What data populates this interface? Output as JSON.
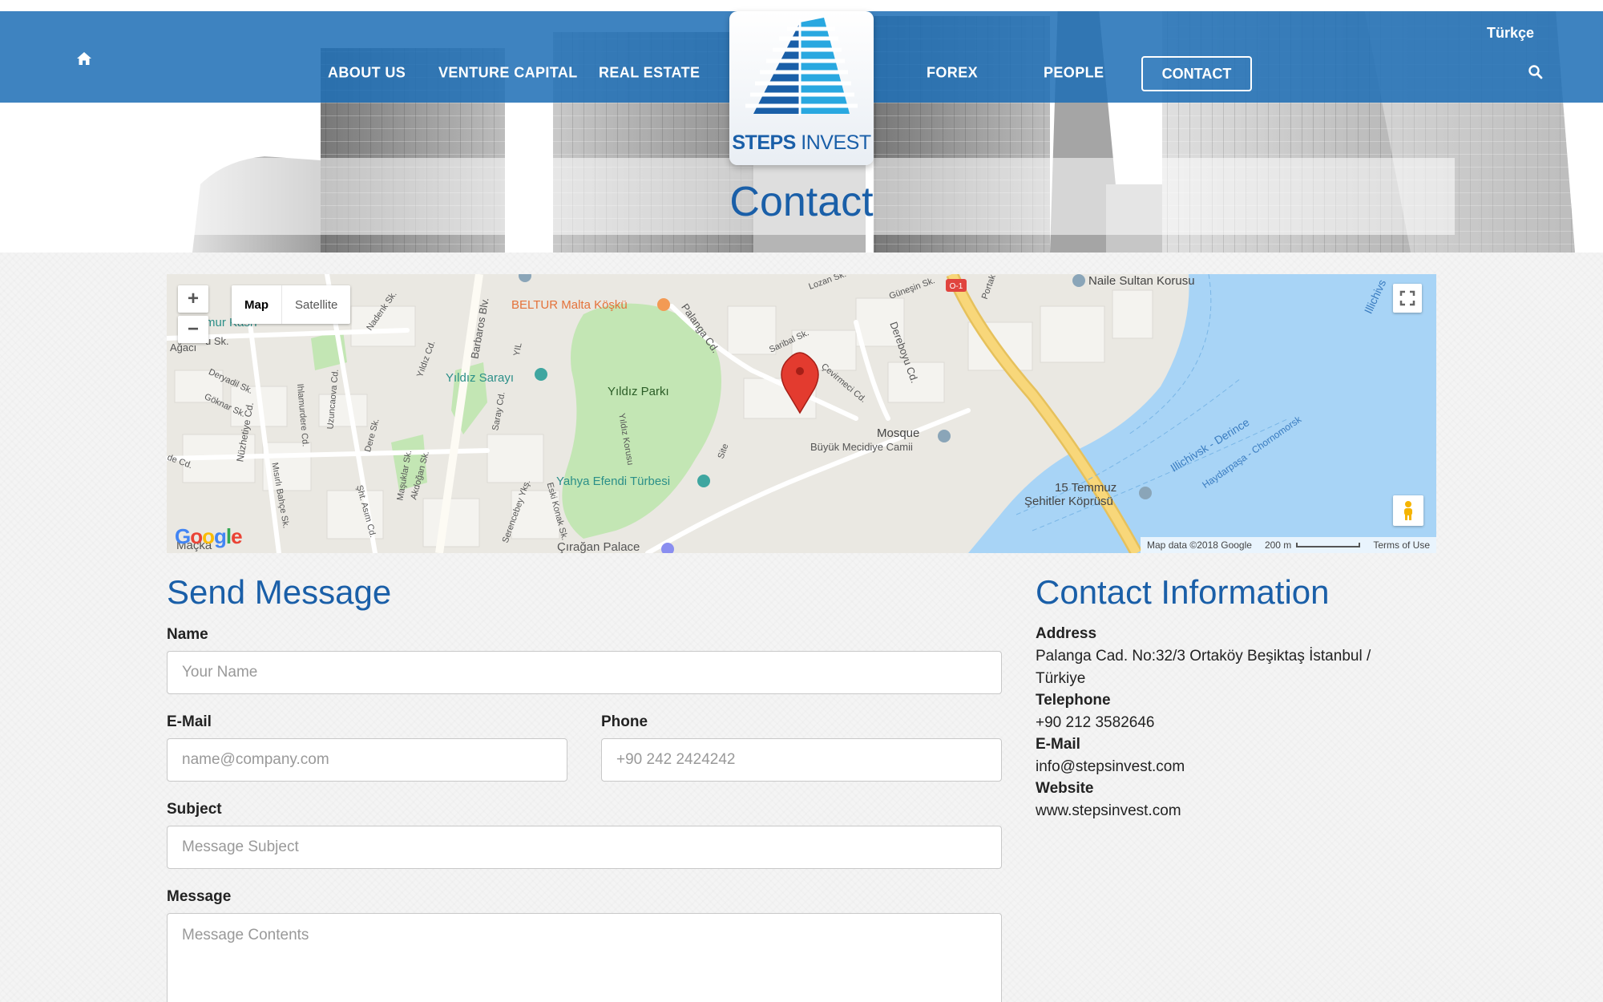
{
  "nav": {
    "items": [
      {
        "label": "ABOUT US"
      },
      {
        "label": "VENTURE CAPITAL"
      },
      {
        "label": "REAL ESTATE"
      },
      {
        "label": "FOREX"
      },
      {
        "label": "PEOPLE"
      },
      {
        "label": "CONTACT"
      }
    ],
    "language": "Türkçe"
  },
  "logo": {
    "bold": "STEPS",
    "light": " INVEST"
  },
  "page_title": "Contact",
  "map": {
    "type_map": "Map",
    "type_satellite": "Satellite",
    "zoom_in": "+",
    "zoom_out": "−",
    "attribution": "Map data ©2018 Google",
    "scale": "200 m",
    "terms": "Terms of Use",
    "google": "Google",
    "places": {
      "beltur": "BELTUR Malta Köşkü",
      "yildiz_sarayi": "Yıldız Sarayı",
      "yildiz_parki": "Yıldız Parkı",
      "yahya": "Yahya Efendi Türbesi",
      "ciragan": "Çırağan Palace",
      "mosque": "Mosque",
      "buyuk_mecidiye": "Büyük Mecidiye Camii",
      "naile": "Naile Sultan Korusu",
      "bridge_1": "15 Temmuz",
      "bridge_2": "Şehitler Köprüsü",
      "ferry_1": "Illichivsk - Derince",
      "ferry_2": "Haydarpaşa - Chornomorsk",
      "ferry_3": "Illichivs",
      "macka": "Maçka",
      "kasri": "mur Kasrı",
      "agaci": "Ağacı",
      "su_sk": "u Sk."
    },
    "streets": {
      "barbaros": "Barbaros Blv.",
      "palanga": "Palanga Cd.",
      "dereboyu": "Dereboyu Cd.",
      "portakal": "Portak",
      "lozan": "Lozan Sk.",
      "gunekin": "Güneşin Sk.",
      "saribal": "Saribal Sk.",
      "cevirmeci": "Çevirmeci Cd.",
      "nuzhetiye": "Nüzhetiye Cd.",
      "deryadil": "Deryadil Sk.",
      "goknar": "Göknar Sk.",
      "ilhamurdere": "Ihlamurdere Cd.",
      "misirli": "Mısırlı Bahçe Sk.",
      "uzuncaova": "Uzuncaova Cd.",
      "dere": "Dere Sk.",
      "sht_asim": "Şht. Asım Cd.",
      "masuklar": "Maşuklar Sk.",
      "akdogan": "Akdoğan Sk.",
      "yildiz_cd": "Yıldız Cd.",
      "saray_cd": "Saray Cd.",
      "serencebey": "Serencebey Ykş.",
      "eski_konak": "Eski Konak Sk.",
      "yildiz_korusu": "Yıldız Korusu",
      "nadenk": "Nadenk Sk.",
      "site": "Site",
      "de_cd": "de Cd.",
      "yil": "YIL",
      "o1": "O-1"
    }
  },
  "form": {
    "title": "Send Message",
    "name_label": "Name",
    "name_placeholder": "Your Name",
    "email_label": "E-Mail",
    "email_placeholder": "name@company.com",
    "phone_label": "Phone",
    "phone_placeholder": "+90 242 2424242",
    "subject_label": "Subject",
    "subject_placeholder": "Message Subject",
    "message_label": "Message",
    "message_placeholder": "Message Contents"
  },
  "contact_info": {
    "title": "Contact Information",
    "address_label": "Address",
    "address_line1": "Palanga Cad. No:32/3 Ortaköy Beşiktaş İstanbul /",
    "address_line2": "Türkiye",
    "telephone_label": "Telephone",
    "telephone": "+90 212 3582646",
    "email_label": "E-Mail",
    "email": "info@stepsinvest.com",
    "website_label": "Website",
    "website": "www.stepsinvest.com"
  },
  "colors": {
    "brand": "#1a5fa8",
    "nav_bg": "#1e6fb6",
    "water": "#a8d4f6",
    "park": "#c3e6b4",
    "highway": "#f8d77a"
  }
}
